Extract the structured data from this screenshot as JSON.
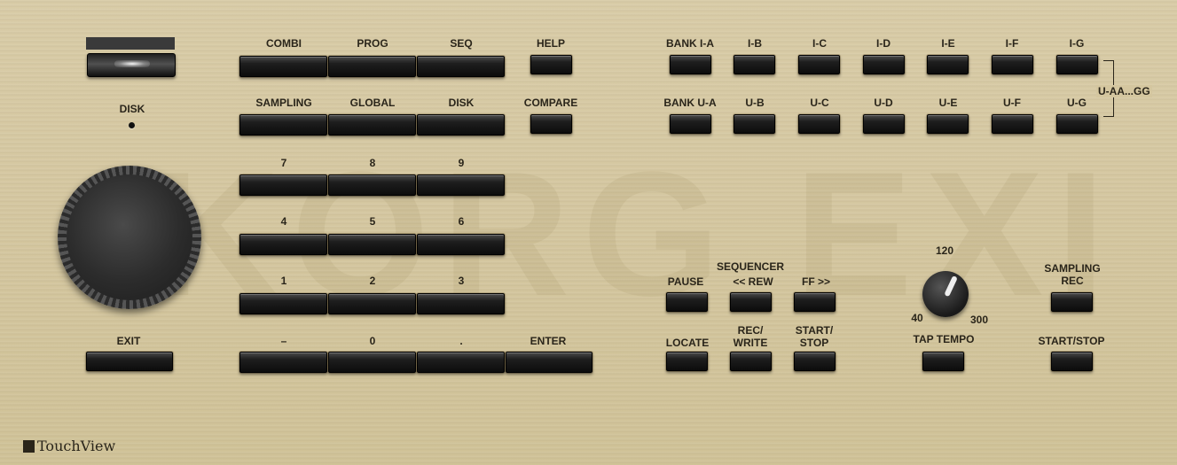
{
  "watermark": "KORG EXI",
  "disk": {
    "label": "DISK"
  },
  "exit": {
    "label": "EXIT"
  },
  "modes": [
    "COMBI",
    "PROG",
    "SEQ",
    "HELP",
    "SAMPLING",
    "GLOBAL",
    "DISK",
    "COMPARE"
  ],
  "keypad": [
    "7",
    "8",
    "9",
    "4",
    "5",
    "6",
    "1",
    "2",
    "3",
    "–",
    "0",
    ".",
    "ENTER"
  ],
  "banks_internal": [
    "BANK I-A",
    "I-B",
    "I-C",
    "I-D",
    "I-E",
    "I-F",
    "I-G"
  ],
  "banks_user": [
    "BANK U-A",
    "U-B",
    "U-C",
    "U-D",
    "U-E",
    "U-F",
    "U-G"
  ],
  "bank_range_label": "U-AA...GG",
  "sequencer": {
    "header": "SEQUENCER",
    "pause": "PAUSE",
    "rew": "<< REW",
    "ff": "FF >>",
    "locate": "LOCATE",
    "rec_write": "REC/\nWRITE",
    "start_stop": "START/\nSTOP"
  },
  "tempo": {
    "min": "40",
    "mid": "120",
    "max": "300",
    "tap_label": "TAP TEMPO"
  },
  "sampling": {
    "rec_label": "SAMPLING\nREC",
    "start_stop_label": "START/STOP"
  },
  "brand": "TouchView"
}
